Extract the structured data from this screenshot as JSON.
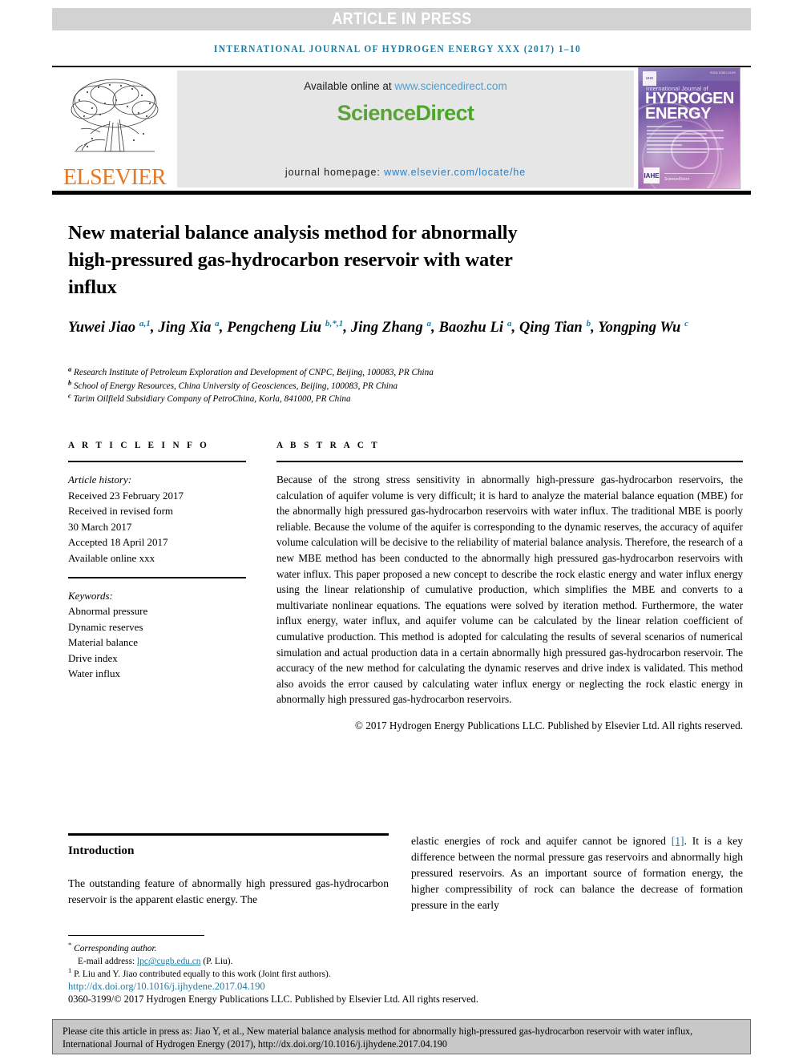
{
  "banner": {
    "article_in_press": "ARTICLE IN PRESS"
  },
  "running_head": "INTERNATIONAL JOURNAL OF HYDROGEN ENERGY XXX (2017) 1–10",
  "masthead": {
    "publisher_name": "ELSEVIER",
    "available_label": "Available online at ",
    "available_url": "www.sciencedirect.com",
    "sciencedirect_part1": "Science",
    "sciencedirect_part2": "Direct",
    "homepage_label": "journal homepage: ",
    "homepage_url": "www.elsevier.com/locate/he",
    "cover": {
      "issn": "ISSN 0360-3199",
      "badge_text": "IJHE",
      "line_international": "International Journal of",
      "line_hydrogen": "HYDROGEN",
      "line_energy": "ENERGY",
      "bottom_badge": "IAHE",
      "bottom_publisher": "ScienceDirect"
    }
  },
  "article": {
    "title": "New material balance analysis method for abnormally high-pressured gas-hydrocarbon reservoir with water influx",
    "authors": [
      {
        "name": "Yuwei Jiao",
        "marks": "a,1",
        "sep": ", "
      },
      {
        "name": "Jing Xia",
        "marks": "a",
        "sep": ", "
      },
      {
        "name": "Pengcheng Liu",
        "marks": "b,*,1",
        "sep": ", "
      },
      {
        "name": "Jing Zhang",
        "marks": "a",
        "sep": ", "
      },
      {
        "name": "Baozhu Li",
        "marks": "a",
        "sep": ", "
      },
      {
        "name": "Qing Tian",
        "marks": "b",
        "sep": ", "
      },
      {
        "name": "Yongping Wu",
        "marks": "c",
        "sep": ""
      }
    ],
    "affiliations": [
      {
        "mark": "a",
        "text": "Research Institute of Petroleum Exploration and Development of CNPC, Beijing, 100083, PR China"
      },
      {
        "mark": "b",
        "text": "School of Energy Resources, China University of Geosciences, Beijing, 100083, PR China"
      },
      {
        "mark": "c",
        "text": "Tarim Oilfield Subsidiary Company of PetroChina, Korla, 841000, PR China"
      }
    ]
  },
  "article_info": {
    "heading": "A R T I C L E   I N F O",
    "history_label": "Article history:",
    "history": [
      "Received 23 February 2017",
      "Received in revised form",
      "30 March 2017",
      "Accepted 18 April 2017",
      "Available online xxx"
    ],
    "keywords_label": "Keywords:",
    "keywords": [
      "Abnormal pressure",
      "Dynamic reserves",
      "Material balance",
      "Drive index",
      "Water influx"
    ]
  },
  "abstract": {
    "heading": "A B S T R A C T",
    "body": "Because of the strong stress sensitivity in abnormally high-pressure gas-hydrocarbon reservoirs, the calculation of aquifer volume is very difficult; it is hard to analyze the material balance equation (MBE) for the abnormally high pressured gas-hydrocarbon reservoirs with water influx. The traditional MBE is poorly reliable. Because the volume of the aquifer is corresponding to the dynamic reserves, the accuracy of aquifer volume calculation will be decisive to the reliability of material balance analysis. Therefore, the research of a new MBE method has been conducted to the abnormally high pressured gas-hydrocarbon reservoirs with water influx. This paper proposed a new concept to describe the rock elastic energy and water influx energy using the linear relationship of cumulative production, which simplifies the MBE and converts to a multivariate nonlinear equations. The equations were solved by iteration method. Furthermore, the water influx energy, water influx, and aquifer volume can be calculated by the linear relation coefficient of cumulative production. This method is adopted for calculating the results of several scenarios of numerical simulation and actual production data in a certain abnormally high pressured gas-hydrocarbon reservoir. The accuracy of the new method for calculating the dynamic reserves and drive index is validated. This method also avoids the error caused by calculating water influx energy or neglecting the rock elastic energy in abnormally high pressured gas-hydrocarbon reservoirs.",
    "copyright": "© 2017 Hydrogen Energy Publications LLC. Published by Elsevier Ltd. All rights reserved."
  },
  "introduction": {
    "heading": "Introduction",
    "left_paragraph": "The outstanding feature of abnormally high pressured gas-hydrocarbon reservoir is the apparent elastic energy. The",
    "right_paragraph_pre": "elastic energies of rock and aquifer cannot be ignored ",
    "right_citation": "[1]",
    "right_paragraph_post": ". It is a key difference between the normal pressure gas reservoirs and abnormally high pressured reservoirs. As an important source of formation energy, the higher compressibility of rock can balance the decrease of formation pressure in the early"
  },
  "footnotes": {
    "corresponding_mark": "*",
    "corresponding_text": "Corresponding author.",
    "email_label": "E-mail address: ",
    "email_address": "lpc@cugb.edu.cn",
    "email_suffix": " (P. Liu).",
    "equal_mark": "1",
    "equal_text": "P. Liu and Y. Jiao contributed equally to this work (Joint first authors).",
    "doi": "http://dx.doi.org/10.1016/j.ijhydene.2017.04.190",
    "issn_copyright": "0360-3199/© 2017 Hydrogen Energy Publications LLC. Published by Elsevier Ltd. All rights reserved."
  },
  "citation_box": {
    "text": "Please cite this article in press as: Jiao Y, et al., New material balance analysis method for abnormally high-pressured gas-hydrocarbon reservoir with water influx, International Journal of Hydrogen Energy (2017), http://dx.doi.org/10.1016/j.ijhydene.2017.04.190"
  }
}
